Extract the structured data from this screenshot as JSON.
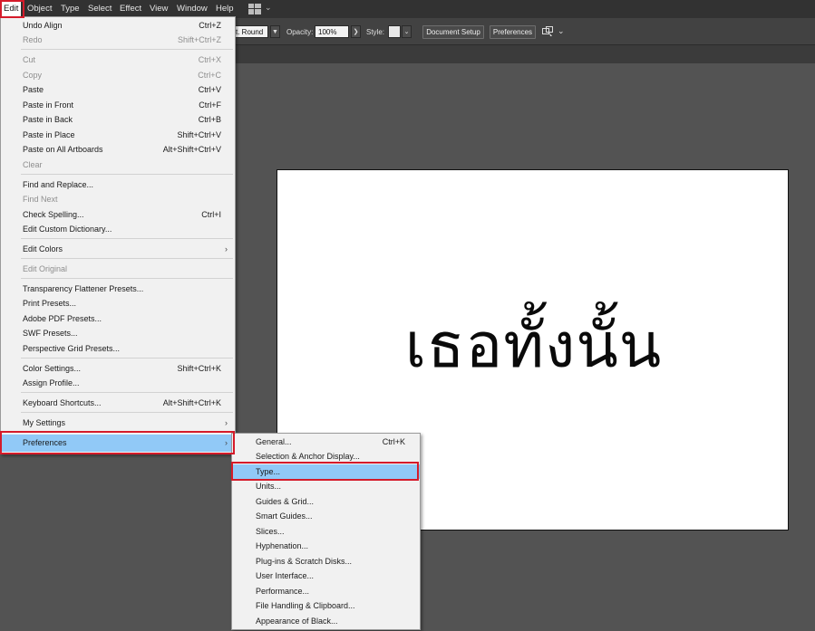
{
  "menubar": {
    "items": [
      "Edit",
      "Object",
      "Type",
      "Select",
      "Effect",
      "View",
      "Window",
      "Help"
    ]
  },
  "controlbar": {
    "stroke_profile": "t. Round",
    "opacity_label": "Opacity:",
    "opacity_value": "100%",
    "style_label": "Style:",
    "document_setup": "Document Setup",
    "preferences": "Preferences"
  },
  "artboard": {
    "text": "เธอทั้งนั้น"
  },
  "edit_menu": {
    "items": [
      {
        "label": "Undo Align",
        "shortcut": "Ctrl+Z"
      },
      {
        "label": "Redo",
        "shortcut": "Shift+Ctrl+Z"
      },
      {
        "label": "Cut",
        "shortcut": "Ctrl+X"
      },
      {
        "label": "Copy",
        "shortcut": "Ctrl+C"
      },
      {
        "label": "Paste",
        "shortcut": "Ctrl+V"
      },
      {
        "label": "Paste in Front",
        "shortcut": "Ctrl+F"
      },
      {
        "label": "Paste in Back",
        "shortcut": "Ctrl+B"
      },
      {
        "label": "Paste in Place",
        "shortcut": "Shift+Ctrl+V"
      },
      {
        "label": "Paste on All Artboards",
        "shortcut": "Alt+Shift+Ctrl+V"
      },
      {
        "label": "Clear",
        "shortcut": ""
      },
      {
        "label": "Find and Replace...",
        "shortcut": ""
      },
      {
        "label": "Find Next",
        "shortcut": ""
      },
      {
        "label": "Check Spelling...",
        "shortcut": "Ctrl+I"
      },
      {
        "label": "Edit Custom Dictionary...",
        "shortcut": ""
      },
      {
        "label": "Edit Colors",
        "shortcut": ""
      },
      {
        "label": "Edit Original",
        "shortcut": ""
      },
      {
        "label": "Transparency Flattener Presets...",
        "shortcut": ""
      },
      {
        "label": "Print Presets...",
        "shortcut": ""
      },
      {
        "label": "Adobe PDF Presets...",
        "shortcut": ""
      },
      {
        "label": "SWF Presets...",
        "shortcut": ""
      },
      {
        "label": "Perspective Grid Presets...",
        "shortcut": ""
      },
      {
        "label": "Color Settings...",
        "shortcut": "Shift+Ctrl+K"
      },
      {
        "label": "Assign Profile...",
        "shortcut": ""
      },
      {
        "label": "Keyboard Shortcuts...",
        "shortcut": "Alt+Shift+Ctrl+K"
      },
      {
        "label": "My Settings",
        "shortcut": ""
      },
      {
        "label": "Preferences",
        "shortcut": ""
      }
    ]
  },
  "preferences_menu": {
    "items": [
      {
        "label": "General...",
        "shortcut": "Ctrl+K"
      },
      {
        "label": "Selection & Anchor Display...",
        "shortcut": ""
      },
      {
        "label": "Type...",
        "shortcut": ""
      },
      {
        "label": "Units...",
        "shortcut": ""
      },
      {
        "label": "Guides & Grid...",
        "shortcut": ""
      },
      {
        "label": "Smart Guides...",
        "shortcut": ""
      },
      {
        "label": "Slices...",
        "shortcut": ""
      },
      {
        "label": "Hyphenation...",
        "shortcut": ""
      },
      {
        "label": "Plug-ins & Scratch Disks...",
        "shortcut": ""
      },
      {
        "label": "User Interface...",
        "shortcut": ""
      },
      {
        "label": "Performance...",
        "shortcut": ""
      },
      {
        "label": "File Handling & Clipboard...",
        "shortcut": ""
      },
      {
        "label": "Appearance of Black...",
        "shortcut": ""
      }
    ]
  },
  "state": {
    "active_menu": "Edit",
    "selected_edit_item": "Preferences",
    "selected_preferences_item": "Type..."
  },
  "colors": {
    "menubar": "#323232",
    "workspace": "#535353",
    "menu_background": "#f1f1f1",
    "selection": "#91c9f7",
    "highlight_box": "#d51b2a"
  }
}
